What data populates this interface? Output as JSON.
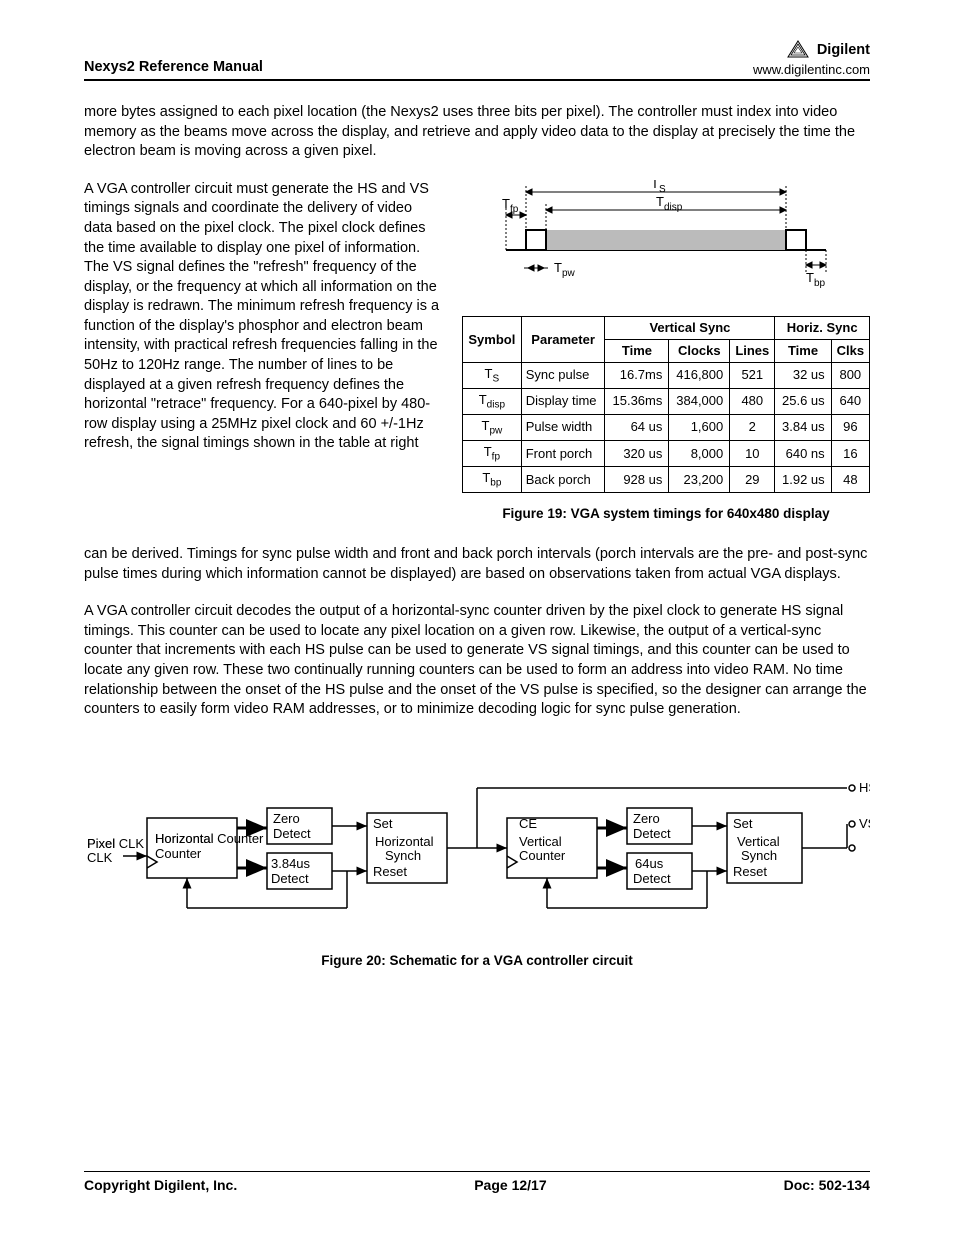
{
  "header": {
    "title": "Nexys2 Reference Manual",
    "brand": "Digilent",
    "url": "www.digilentinc.com"
  },
  "para1": "more bytes assigned to each pixel location (the Nexys2 uses three bits per pixel). The controller must index into video memory as the beams move across the display, and retrieve and apply video data to the display at precisely the time the electron beam is moving across a given pixel.",
  "para2": "A VGA controller circuit must generate the HS and VS timings signals and coordinate the delivery of video data based on the pixel clock. The pixel clock defines the time available to display one pixel of information. The VS signal defines the \"refresh\" frequency of the display, or the frequency at which all information on the display is redrawn. The minimum refresh frequency is a function of the display's phosphor and electron beam intensity, with practical refresh frequencies falling in the 50Hz to 120Hz range. The number of lines to be displayed at a given refresh frequency defines the horizontal \"retrace\" frequency. For a 640-pixel by 480-row display using a 25MHz pixel clock and 60 +/-1Hz refresh, the signal timings shown in the table at right",
  "para3": "can be derived. Timings for sync pulse width and front and back porch intervals (porch intervals are the pre- and post-sync pulse times during which information cannot be displayed) are based on observations taken from actual VGA displays.",
  "para4": "A VGA controller circuit decodes the output of a horizontal-sync counter driven by the pixel clock to generate HS signal timings. This counter can be used to locate any pixel location on a given row. Likewise, the output of a vertical-sync counter that increments with each HS pulse can be used to generate VS signal timings, and this counter can be used to locate any given row. These two continually running counters can be used to form an address into video RAM. No time relationship between the onset of the HS pulse and the onset of the VS pulse is specified, so the designer can arrange the counters to easily form video RAM addresses, or to minimize decoding logic for sync pulse generation.",
  "diagram_labels": {
    "Ts": "T",
    "Ts_sub": "S",
    "Tfp": "T",
    "Tfp_sub": "fp",
    "Tdisp": "T",
    "Tdisp_sub": "disp",
    "Tpw": "T",
    "Tpw_sub": "pw",
    "Tbp": "T",
    "Tbp_sub": "bp"
  },
  "table": {
    "headers": {
      "symbol": "Symbol",
      "parameter": "Parameter",
      "vsync": "Vertical Sync",
      "hsync": "Horiz. Sync",
      "time": "Time",
      "clocks": "Clocks",
      "lines": "Lines",
      "clks": "Clks"
    },
    "rows": [
      {
        "sym": "T",
        "sub": "S",
        "param": "Sync pulse",
        "vt": "16.7ms",
        "vc": "416,800",
        "vl": "521",
        "ht": "32 us",
        "hc": "800"
      },
      {
        "sym": "T",
        "sub": "disp",
        "param": "Display time",
        "vt": "15.36ms",
        "vc": "384,000",
        "vl": "480",
        "ht": "25.6 us",
        "hc": "640"
      },
      {
        "sym": "T",
        "sub": "pw",
        "param": "Pulse width",
        "vt": "64 us",
        "vc": "1,600",
        "vl": "2",
        "ht": "3.84 us",
        "hc": "96"
      },
      {
        "sym": "T",
        "sub": "fp",
        "param": "Front porch",
        "vt": "320 us",
        "vc": "8,000",
        "vl": "10",
        "ht": "640 ns",
        "hc": "16"
      },
      {
        "sym": "T",
        "sub": "bp",
        "param": "Back porch",
        "vt": "928 us",
        "vc": "23,200",
        "vl": "29",
        "ht": "1.92 us",
        "hc": "48"
      }
    ]
  },
  "caption19": "Figure 19: VGA system timings for 640x480 display",
  "caption20": "Figure 20: Schematic for a VGA controller circuit",
  "schematic": {
    "pixel_clk": "Pixel CLK",
    "hcounter": "Horizontal Counter",
    "zero_detect": "Zero Detect",
    "d384": "3.84us Detect",
    "hsync": "Horizontal Synch",
    "set": "Set",
    "reset": "Reset",
    "ce": "CE",
    "vcounter": "Vertical Counter",
    "d64": "64us Detect",
    "vsync": "Vertical Synch",
    "hs": "HS",
    "vs": "VS"
  },
  "footer": {
    "copyright": "Copyright Digilent, Inc.",
    "page": "Page 12/17",
    "doc": "Doc: 502-134"
  }
}
